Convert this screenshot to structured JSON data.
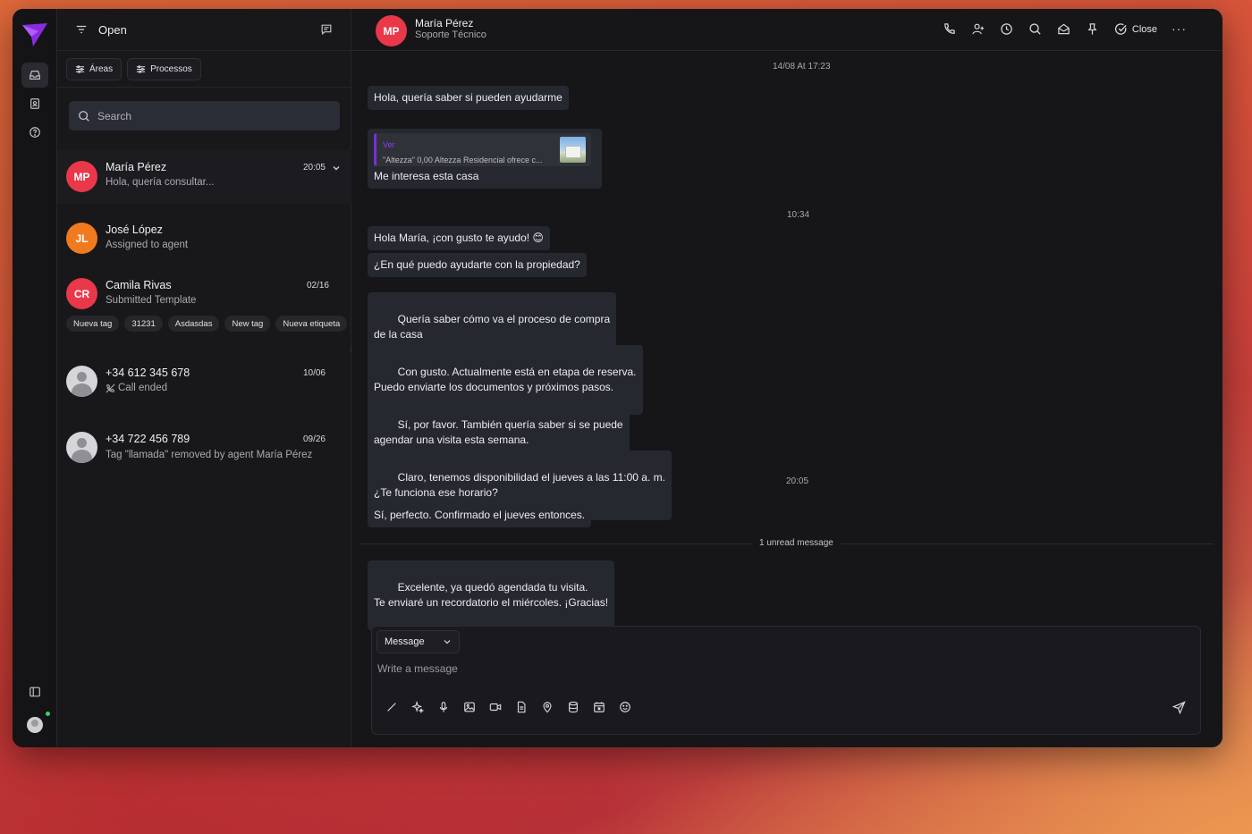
{
  "sidebar": {
    "nav": [
      {
        "icon": "inbox-icon"
      },
      {
        "icon": "contacts-icon"
      },
      {
        "icon": "help-icon"
      }
    ]
  },
  "list": {
    "title": "Open",
    "filters": [
      "Áreas",
      "Processos"
    ],
    "search_placeholder": "Search",
    "conversations": [
      {
        "initials": "MP",
        "name": "María Pérez",
        "preview": "Hola, quería consultar...",
        "time": "20:05",
        "color": "#e8384a"
      },
      {
        "initials": "JL",
        "name": "José López",
        "preview": "Assigned to agent",
        "time": "",
        "color": "#f07b1f"
      },
      {
        "initials": "CR",
        "name": "Camila Rivas",
        "preview": "Submitted Template",
        "time": "02/16",
        "color": "#e8384a",
        "tags": [
          "Nueva tag",
          "31231",
          "Asdasdas",
          "New tag",
          "Nueva etiqueta"
        ]
      },
      {
        "initials": "",
        "name": "+34 612 345 678",
        "preview": "Call ended",
        "time": "10/06"
      },
      {
        "initials": "",
        "name": "+34 722 456 789",
        "preview": "Tag \"llamada\" removed by agent María Pérez",
        "time": "09/26"
      }
    ]
  },
  "chat": {
    "contact_initials": "MP",
    "contact_name": "María Pérez",
    "contact_subtitle": "Soporte Técnico",
    "close_label": "Close",
    "more_label": "···",
    "stamps": [
      "14/08 At 17:23",
      "10:34",
      "20:05"
    ],
    "quote": {
      "title": "Ver",
      "text": "\"Altezza\" 0,00 Altezza Residencial ofrece c..."
    },
    "messages": [
      {
        "text": "Hola, quería saber si pueden ayudarme"
      },
      {
        "text": "Me interesa esta casa"
      },
      {
        "text": "Hola María, ¡con gusto te ayudo! 😊"
      },
      {
        "text": "¿En qué puedo ayudarte con la propiedad?"
      },
      {
        "text": "Quería saber cómo va el proceso de compra\nde la casa"
      },
      {
        "text": "Con gusto. Actualmente está en etapa de reserva.\nPuedo enviarte los documentos y próximos pasos."
      },
      {
        "text": "Sí, por favor. También quería saber si se puede\nagendar una visita esta semana."
      },
      {
        "text": "Claro, tenemos disponibilidad el jueves a las 11:00 a. m.\n¿Te funciona ese horario?"
      },
      {
        "text": "Sí, perfecto. Confirmado el jueves entonces."
      },
      {
        "text": "Excelente, ya quedó agendada tu visita.\nTe enviaré un recordatorio el miércoles. ¡Gracias!"
      }
    ],
    "unread_label": "1 unread message"
  },
  "composer": {
    "type_label": "Message",
    "placeholder": "Write a message"
  },
  "colors": {
    "accent": "#7b2ed6",
    "avatar_red": "#e8384a",
    "avatar_orange": "#f07b1f",
    "online": "#3ad065"
  }
}
